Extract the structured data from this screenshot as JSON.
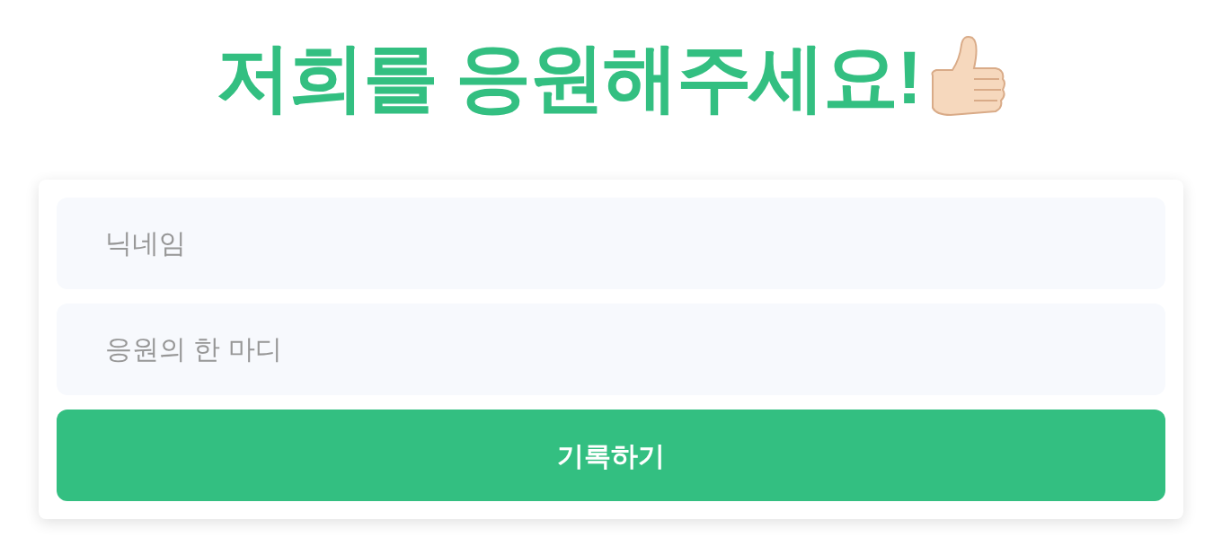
{
  "title": "저희를 응원해주세요!",
  "fields": [
    {
      "placeholder": "닉네임"
    },
    {
      "placeholder": "응원의 한 마디"
    }
  ],
  "button": "기록하기"
}
